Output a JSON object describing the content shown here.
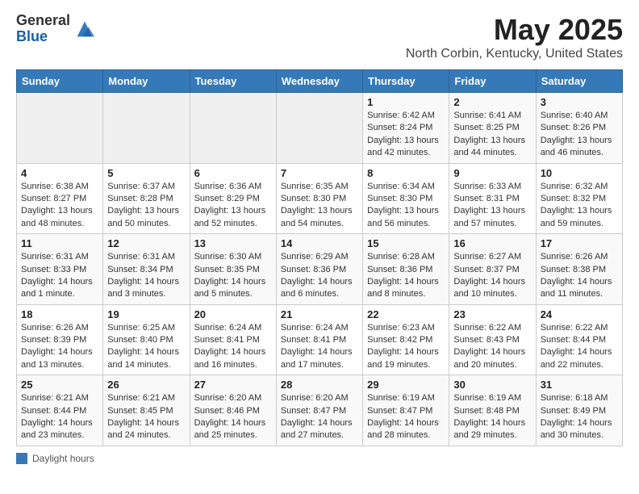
{
  "header": {
    "logo_general": "General",
    "logo_blue": "Blue",
    "month_year": "May 2025",
    "location": "North Corbin, Kentucky, United States"
  },
  "weekdays": [
    "Sunday",
    "Monday",
    "Tuesday",
    "Wednesday",
    "Thursday",
    "Friday",
    "Saturday"
  ],
  "legend": {
    "label": "Daylight hours"
  },
  "weeks": [
    [
      {
        "day": "",
        "sunrise": "",
        "sunset": "",
        "daylight": "",
        "empty": true
      },
      {
        "day": "",
        "sunrise": "",
        "sunset": "",
        "daylight": "",
        "empty": true
      },
      {
        "day": "",
        "sunrise": "",
        "sunset": "",
        "daylight": "",
        "empty": true
      },
      {
        "day": "",
        "sunrise": "",
        "sunset": "",
        "daylight": "",
        "empty": true
      },
      {
        "day": "1",
        "sunrise": "Sunrise: 6:42 AM",
        "sunset": "Sunset: 8:24 PM",
        "daylight": "Daylight: 13 hours and 42 minutes.",
        "empty": false
      },
      {
        "day": "2",
        "sunrise": "Sunrise: 6:41 AM",
        "sunset": "Sunset: 8:25 PM",
        "daylight": "Daylight: 13 hours and 44 minutes.",
        "empty": false
      },
      {
        "day": "3",
        "sunrise": "Sunrise: 6:40 AM",
        "sunset": "Sunset: 8:26 PM",
        "daylight": "Daylight: 13 hours and 46 minutes.",
        "empty": false
      }
    ],
    [
      {
        "day": "4",
        "sunrise": "Sunrise: 6:38 AM",
        "sunset": "Sunset: 8:27 PM",
        "daylight": "Daylight: 13 hours and 48 minutes.",
        "empty": false
      },
      {
        "day": "5",
        "sunrise": "Sunrise: 6:37 AM",
        "sunset": "Sunset: 8:28 PM",
        "daylight": "Daylight: 13 hours and 50 minutes.",
        "empty": false
      },
      {
        "day": "6",
        "sunrise": "Sunrise: 6:36 AM",
        "sunset": "Sunset: 8:29 PM",
        "daylight": "Daylight: 13 hours and 52 minutes.",
        "empty": false
      },
      {
        "day": "7",
        "sunrise": "Sunrise: 6:35 AM",
        "sunset": "Sunset: 8:30 PM",
        "daylight": "Daylight: 13 hours and 54 minutes.",
        "empty": false
      },
      {
        "day": "8",
        "sunrise": "Sunrise: 6:34 AM",
        "sunset": "Sunset: 8:30 PM",
        "daylight": "Daylight: 13 hours and 56 minutes.",
        "empty": false
      },
      {
        "day": "9",
        "sunrise": "Sunrise: 6:33 AM",
        "sunset": "Sunset: 8:31 PM",
        "daylight": "Daylight: 13 hours and 57 minutes.",
        "empty": false
      },
      {
        "day": "10",
        "sunrise": "Sunrise: 6:32 AM",
        "sunset": "Sunset: 8:32 PM",
        "daylight": "Daylight: 13 hours and 59 minutes.",
        "empty": false
      }
    ],
    [
      {
        "day": "11",
        "sunrise": "Sunrise: 6:31 AM",
        "sunset": "Sunset: 8:33 PM",
        "daylight": "Daylight: 14 hours and 1 minute.",
        "empty": false
      },
      {
        "day": "12",
        "sunrise": "Sunrise: 6:31 AM",
        "sunset": "Sunset: 8:34 PM",
        "daylight": "Daylight: 14 hours and 3 minutes.",
        "empty": false
      },
      {
        "day": "13",
        "sunrise": "Sunrise: 6:30 AM",
        "sunset": "Sunset: 8:35 PM",
        "daylight": "Daylight: 14 hours and 5 minutes.",
        "empty": false
      },
      {
        "day": "14",
        "sunrise": "Sunrise: 6:29 AM",
        "sunset": "Sunset: 8:36 PM",
        "daylight": "Daylight: 14 hours and 6 minutes.",
        "empty": false
      },
      {
        "day": "15",
        "sunrise": "Sunrise: 6:28 AM",
        "sunset": "Sunset: 8:36 PM",
        "daylight": "Daylight: 14 hours and 8 minutes.",
        "empty": false
      },
      {
        "day": "16",
        "sunrise": "Sunrise: 6:27 AM",
        "sunset": "Sunset: 8:37 PM",
        "daylight": "Daylight: 14 hours and 10 minutes.",
        "empty": false
      },
      {
        "day": "17",
        "sunrise": "Sunrise: 6:26 AM",
        "sunset": "Sunset: 8:38 PM",
        "daylight": "Daylight: 14 hours and 11 minutes.",
        "empty": false
      }
    ],
    [
      {
        "day": "18",
        "sunrise": "Sunrise: 6:26 AM",
        "sunset": "Sunset: 8:39 PM",
        "daylight": "Daylight: 14 hours and 13 minutes.",
        "empty": false
      },
      {
        "day": "19",
        "sunrise": "Sunrise: 6:25 AM",
        "sunset": "Sunset: 8:40 PM",
        "daylight": "Daylight: 14 hours and 14 minutes.",
        "empty": false
      },
      {
        "day": "20",
        "sunrise": "Sunrise: 6:24 AM",
        "sunset": "Sunset: 8:41 PM",
        "daylight": "Daylight: 14 hours and 16 minutes.",
        "empty": false
      },
      {
        "day": "21",
        "sunrise": "Sunrise: 6:24 AM",
        "sunset": "Sunset: 8:41 PM",
        "daylight": "Daylight: 14 hours and 17 minutes.",
        "empty": false
      },
      {
        "day": "22",
        "sunrise": "Sunrise: 6:23 AM",
        "sunset": "Sunset: 8:42 PM",
        "daylight": "Daylight: 14 hours and 19 minutes.",
        "empty": false
      },
      {
        "day": "23",
        "sunrise": "Sunrise: 6:22 AM",
        "sunset": "Sunset: 8:43 PM",
        "daylight": "Daylight: 14 hours and 20 minutes.",
        "empty": false
      },
      {
        "day": "24",
        "sunrise": "Sunrise: 6:22 AM",
        "sunset": "Sunset: 8:44 PM",
        "daylight": "Daylight: 14 hours and 22 minutes.",
        "empty": false
      }
    ],
    [
      {
        "day": "25",
        "sunrise": "Sunrise: 6:21 AM",
        "sunset": "Sunset: 8:44 PM",
        "daylight": "Daylight: 14 hours and 23 minutes.",
        "empty": false
      },
      {
        "day": "26",
        "sunrise": "Sunrise: 6:21 AM",
        "sunset": "Sunset: 8:45 PM",
        "daylight": "Daylight: 14 hours and 24 minutes.",
        "empty": false
      },
      {
        "day": "27",
        "sunrise": "Sunrise: 6:20 AM",
        "sunset": "Sunset: 8:46 PM",
        "daylight": "Daylight: 14 hours and 25 minutes.",
        "empty": false
      },
      {
        "day": "28",
        "sunrise": "Sunrise: 6:20 AM",
        "sunset": "Sunset: 8:47 PM",
        "daylight": "Daylight: 14 hours and 27 minutes.",
        "empty": false
      },
      {
        "day": "29",
        "sunrise": "Sunrise: 6:19 AM",
        "sunset": "Sunset: 8:47 PM",
        "daylight": "Daylight: 14 hours and 28 minutes.",
        "empty": false
      },
      {
        "day": "30",
        "sunrise": "Sunrise: 6:19 AM",
        "sunset": "Sunset: 8:48 PM",
        "daylight": "Daylight: 14 hours and 29 minutes.",
        "empty": false
      },
      {
        "day": "31",
        "sunrise": "Sunrise: 6:18 AM",
        "sunset": "Sunset: 8:49 PM",
        "daylight": "Daylight: 14 hours and 30 minutes.",
        "empty": false
      }
    ]
  ]
}
